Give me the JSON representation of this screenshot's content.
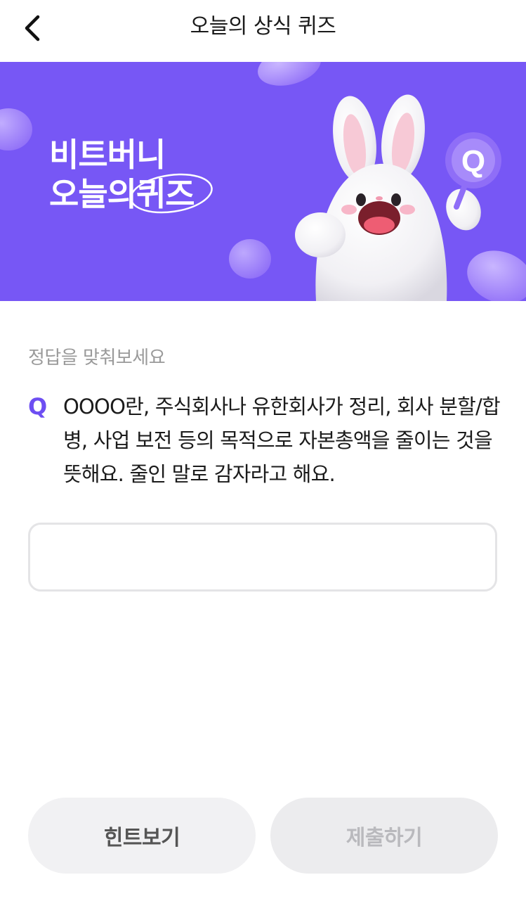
{
  "header": {
    "title": "오늘의 상식 퀴즈"
  },
  "banner": {
    "line1": "비트버니",
    "line2_prefix": "오늘의",
    "line2_emphasis": "퀴즈",
    "badge_letter": "Q",
    "background_color": "#7757f5"
  },
  "question": {
    "instruction": "정답을 맞춰보세요",
    "marker": "Q",
    "text": "OOOO란, 주식회사나 유한회사가 정리, 회사 분할/합병, 사업 보전 등의 목적으로 자본총액을 줄이는 것을 뜻해요. 줄인 말로 감자라고 해요."
  },
  "answer": {
    "value": "",
    "placeholder": ""
  },
  "buttons": {
    "hint_label": "힌트보기",
    "submit_label": "제출하기"
  },
  "icons": {
    "back": "chevron-left-icon",
    "mascot": "bunny-mascot-illustration"
  }
}
